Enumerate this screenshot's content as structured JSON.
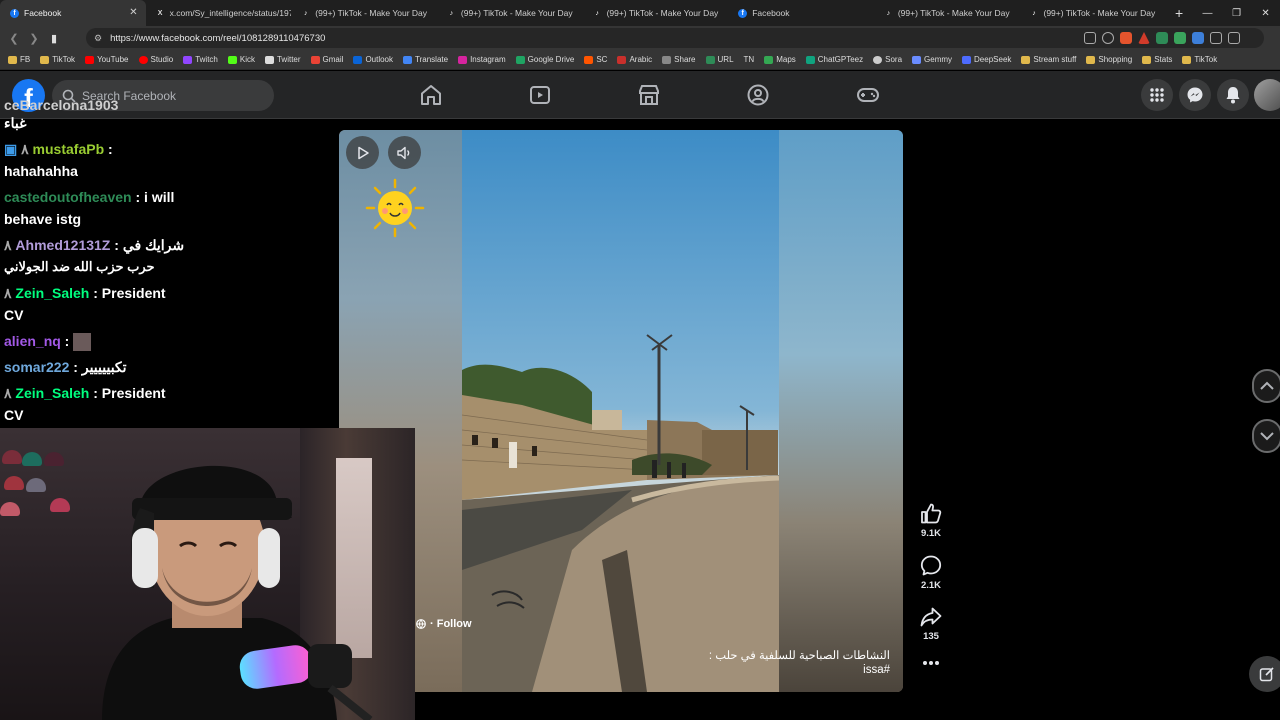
{
  "browser": {
    "tabs": [
      {
        "label": "Facebook",
        "icon": "facebook-icon",
        "active": true
      },
      {
        "label": "x.com/Sy_intelligence/status/197",
        "icon": "x-icon"
      },
      {
        "label": "(99+) TikTok - Make Your Day",
        "icon": "tiktok-icon"
      },
      {
        "label": "(99+) TikTok - Make Your Day",
        "icon": "tiktok-icon"
      },
      {
        "label": "(99+) TikTok - Make Your Day",
        "icon": "tiktok-icon"
      },
      {
        "label": "Facebook",
        "icon": "facebook-icon"
      },
      {
        "label": "(99+) TikTok - Make Your Day",
        "icon": "tiktok-icon"
      },
      {
        "label": "(99+) TikTok - Make Your Day",
        "icon": "tiktok-icon"
      }
    ],
    "url": "https://www.facebook.com/reel/1081289110476730",
    "bookmarks": [
      "FB",
      "TikTok",
      "YouTube",
      "Studio",
      "Twitch",
      "Kick",
      "Twitter",
      "Gmail",
      "Outlook",
      "Translate",
      "Instagram",
      "Google Drive",
      "SC",
      "Arabic",
      "Share",
      "URL",
      "TN",
      "Maps",
      "ChatGPTeez",
      "Sora",
      "Gemmy",
      "DeepSeek",
      "Stream stuff",
      "Shopping",
      "Stats",
      "TikTok"
    ]
  },
  "facebook": {
    "logo": "f",
    "search_placeholder": "Search Facebook"
  },
  "chat": {
    "messages": [
      {
        "user": "ceBarcelona1903",
        "text": "غباء",
        "color": "#ffffff"
      },
      {
        "user": "mustafaPb",
        "text": "hahahahha",
        "color": "#9acd32"
      },
      {
        "user": "castedoutofheaven",
        "text": "i will behave istg",
        "color": "#2e8b57"
      },
      {
        "user": "Ahmed12131Z",
        "text": "شرايك في حرب حزب الله ضد الجولاني",
        "color": "#b19cd9"
      },
      {
        "user": "Zein_Saleh",
        "text": "President CV",
        "color": "#00ff7f"
      },
      {
        "user": "alien_nq",
        "text": "",
        "color": "#8a2be2"
      },
      {
        "user": "somar222",
        "text": "تكبييييير",
        "color": "#6fa8dc"
      },
      {
        "user": "Zein_Saleh",
        "text": "President CV",
        "color": "#00ff7f"
      }
    ]
  },
  "reel": {
    "follow_label": "· Follow",
    "caption_line1": "النشاطات الصباحية للسلفية في حلب :",
    "caption_line2": "issa#",
    "likes": "9.1K",
    "comments": "2.1K",
    "shares": "135"
  },
  "colors": {
    "fb_blue": "#1877f2",
    "header_bg": "#242526",
    "tab_active": "#353535"
  }
}
